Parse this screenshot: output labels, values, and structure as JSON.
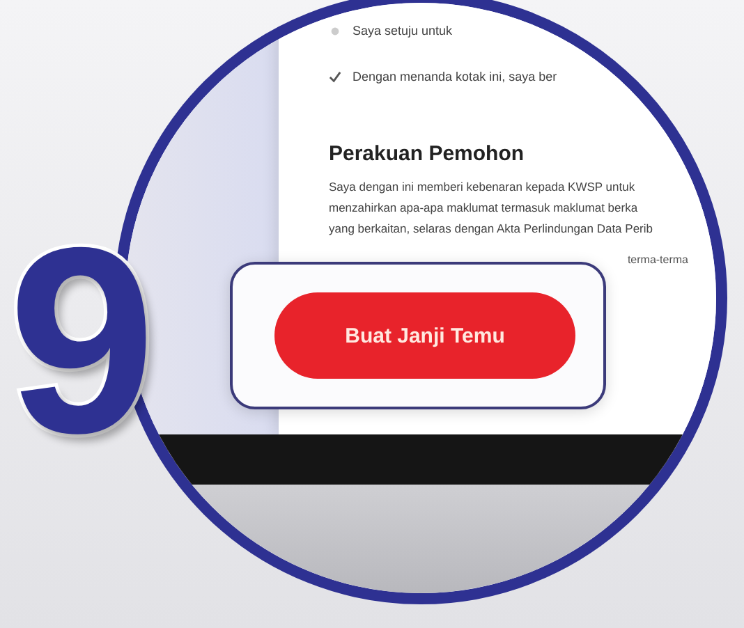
{
  "step_number": "9",
  "document": {
    "consent_lines": [
      {
        "text": "Saya setuju untuk",
        "checked": false
      },
      {
        "text": "Dengan menanda kotak ini, saya ber",
        "checked": true
      }
    ],
    "heading": "Perakuan Pemohon",
    "paragraph_lines": [
      "Saya dengan ini memberi kebenaran kepada KWSP untuk",
      "menzahirkan apa-apa maklumat termasuk maklumat berka",
      "yang berkaitan, selaras dengan Akta Perlindungan Data Perib"
    ],
    "side_text": "terma-terma"
  },
  "button": {
    "label": "Buat Janji Temu"
  }
}
